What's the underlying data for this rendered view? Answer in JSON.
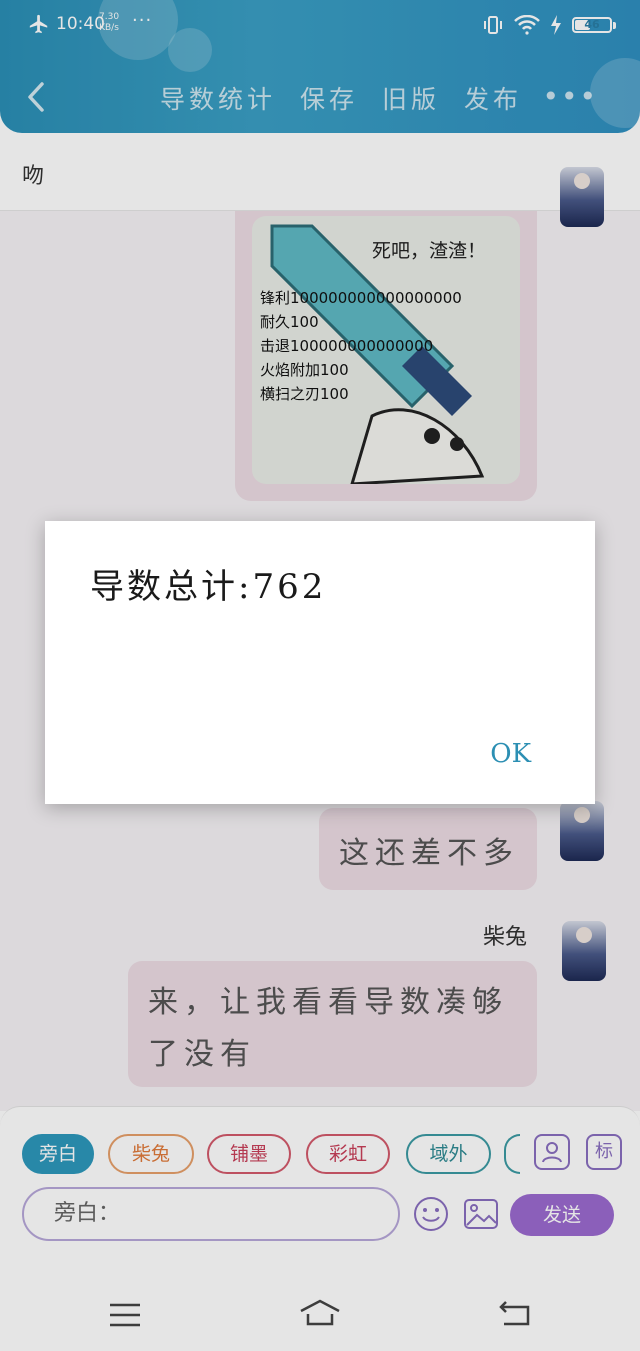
{
  "status": {
    "time": "10:40",
    "speed_value": "7.30",
    "speed_unit": "KB/s",
    "dots": "···",
    "battery": "46"
  },
  "header": {
    "actions": [
      "导数统计",
      "保存",
      "旧版",
      "发布"
    ],
    "more": "•••"
  },
  "title": {
    "text": "吻"
  },
  "chat": {
    "meme": {
      "caption": "死吧，渣渣！",
      "lines": [
        "锋利100000000000000000",
        "耐久100",
        "击退100000000000000",
        "火焰附加100",
        "横扫之刃100"
      ]
    },
    "message1": "这还差不多",
    "sender": "柴兔",
    "message2": "来，让我看看导数凑够了没有"
  },
  "toolbar": {
    "chips": [
      "旁白",
      "柴兔",
      "铺墨",
      "彩虹",
      "域外"
    ],
    "profile_icon": "person-icon",
    "tag_label": "标",
    "input_placeholder": "旁白：",
    "send_label": "发送"
  },
  "dialog": {
    "message": "导数总计:762",
    "ok_label": "OK"
  },
  "colors": {
    "appbar": "#2b8fb6",
    "accent": "#2c8fb3",
    "send": "#9b6ad0",
    "bubble": "#ecdce4"
  }
}
